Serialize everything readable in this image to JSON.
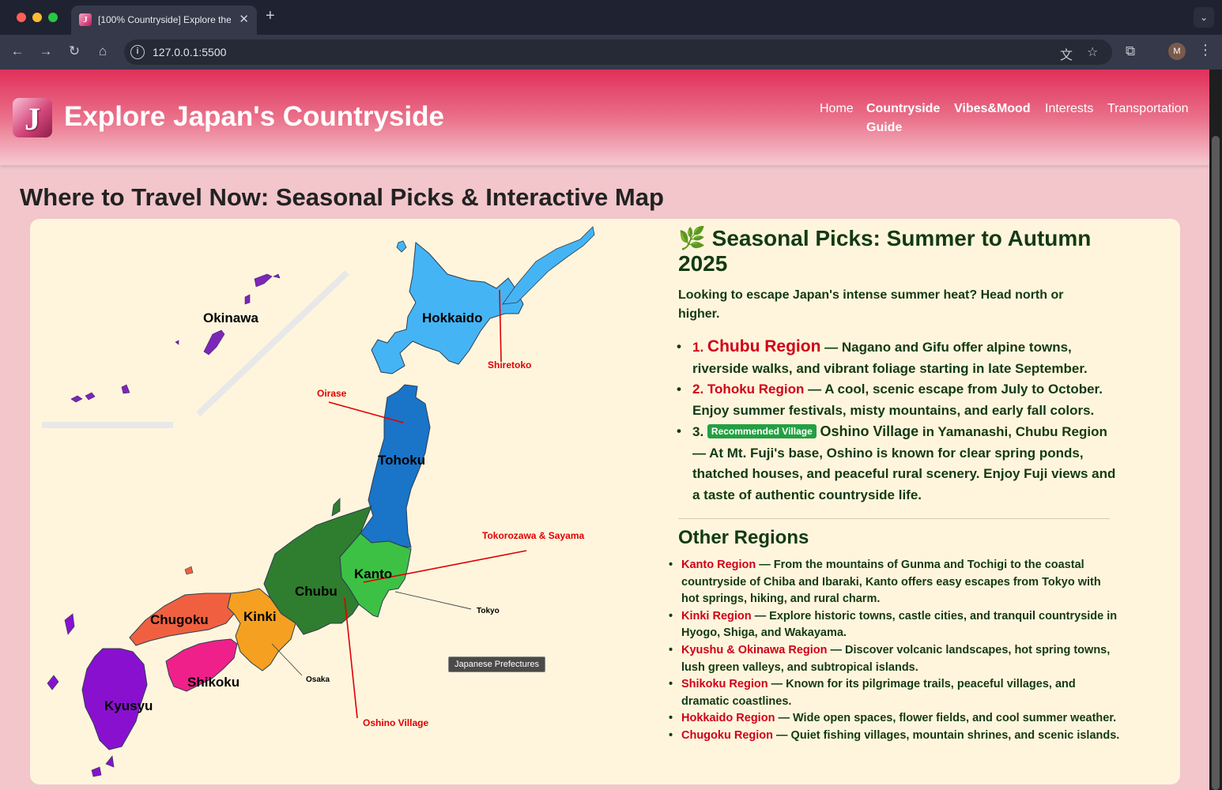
{
  "browser": {
    "tab_title": "[100% Countryside] Explore the",
    "url": "127.0.0.1:5500",
    "avatar_initial": "M"
  },
  "header": {
    "logo_letter": "J",
    "title": "Explore Japan's Countryside",
    "nav": [
      {
        "label": "Home",
        "active": false
      },
      {
        "label": "Countryside",
        "active": true
      },
      {
        "label": "Guide",
        "active": true
      },
      {
        "label": "Vibes&Mood",
        "active": true
      },
      {
        "label": "Interests",
        "active": false
      },
      {
        "label": "Transportation",
        "active": false
      }
    ]
  },
  "page_heading": "Where to Travel Now: Seasonal Picks & Interactive Map",
  "map": {
    "tooltip": "Japanese Prefectures",
    "region_labels": {
      "okinawa": "Okinawa",
      "hokkaido": "Hokkaido",
      "tohoku": "Tohoku",
      "kanto": "Kanto",
      "chubu": "Chubu",
      "kinki": "Kinki",
      "chugoku": "Chugoku",
      "shikoku": "Shikoku",
      "kyusyu": "Kyusyu"
    },
    "callouts": {
      "shiretoko": "Shiretoko",
      "oirase": "Oirase",
      "tokorozawa": "Tokorozawa & Sayama",
      "tokyo": "Tokyo",
      "osaka": "Osaka",
      "oshino": "Oshino Village"
    },
    "colors": {
      "hokkaido": "#45b4f5",
      "tohoku": "#1a74c8",
      "kanto": "#3cc145",
      "chubu": "#2f7d2f",
      "kinki": "#f5a020",
      "chugoku": "#f06040",
      "shikoku": "#f0208a",
      "kyusyu": "#8a10d0",
      "okinawa": "#7a28b8"
    }
  },
  "picks": {
    "title": "🌿 Seasonal Picks: Summer to Autumn 2025",
    "intro": "Looking to escape Japan's intense summer heat? Head north or higher.",
    "items": [
      {
        "num": "1.",
        "name": "Chubu Region",
        "text": " — Nagano and Gifu offer alpine towns, riverside walks, and vibrant foliage starting in late September."
      },
      {
        "num": "2.",
        "name": "Tohoku Region",
        "text": " — A cool, scenic escape from July to October. Enjoy summer festivals, misty mountains, and early fall colors."
      },
      {
        "num": "3.",
        "badge": "Recommended Village",
        "name": "Oshino Village",
        "text": " in Yamanashi, Chubu Region — At Mt. Fuji's base, Oshino is known for clear spring ponds, thatched houses, and peaceful rural scenery. Enjoy Fuji views and a taste of authentic countryside life."
      }
    ]
  },
  "other_regions": {
    "title": "Other Regions",
    "items": [
      {
        "name": "Kanto Region",
        "text": " — From the mountains of Gunma and Tochigi to the coastal countryside of Chiba and Ibaraki, Kanto offers easy escapes from Tokyo with hot springs, hiking, and rural charm."
      },
      {
        "name": "Kinki Region",
        "text": " — Explore historic towns, castle cities, and tranquil countryside in Hyogo, Shiga, and Wakayama."
      },
      {
        "name": "Kyushu & Okinawa Region",
        "text": " — Discover volcanic landscapes, hot spring towns, lush green valleys, and subtropical islands."
      },
      {
        "name": "Shikoku Region",
        "text": " — Known for its pilgrimage trails, peaceful villages, and dramatic coastlines."
      },
      {
        "name": "Hokkaido Region",
        "text": " — Wide open spaces, flower fields, and cool summer weather."
      },
      {
        "name": "Chugoku Region",
        "text": " — Quiet fishing villages, mountain shrines, and scenic islands."
      }
    ]
  }
}
